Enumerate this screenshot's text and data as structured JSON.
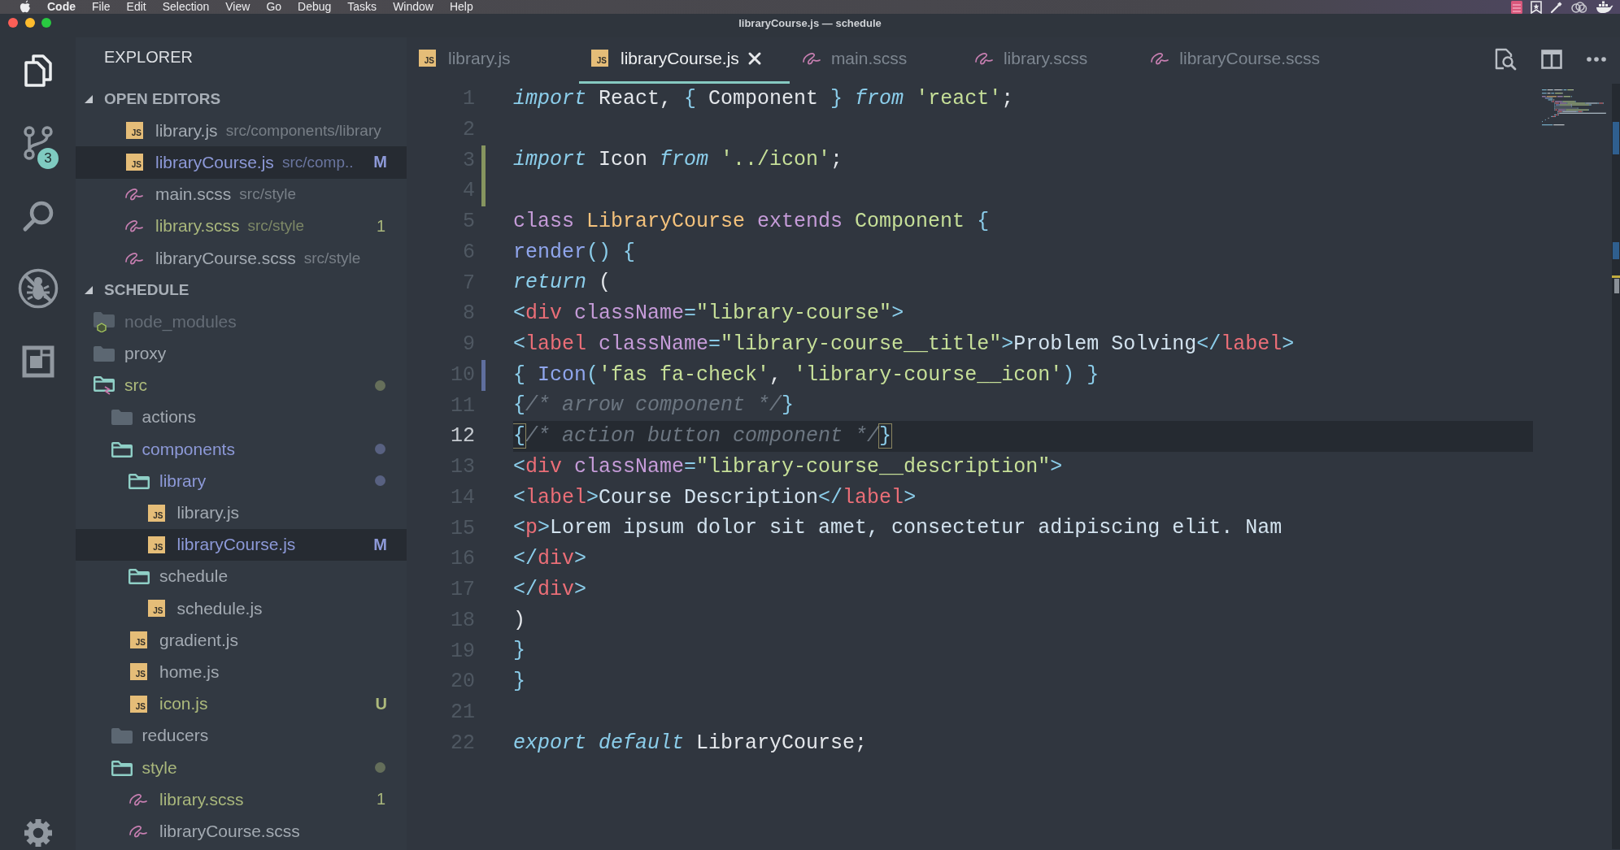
{
  "menu_bar": {
    "app_name": "Code",
    "items": [
      "File",
      "Edit",
      "Selection",
      "View",
      "Go",
      "Debug",
      "Tasks",
      "Window",
      "Help"
    ]
  },
  "window": {
    "title": "libraryCourse.js — schedule"
  },
  "activity_bar": {
    "items": [
      {
        "kind": "files",
        "selected": true
      },
      {
        "kind": "source-control",
        "selected": false,
        "badge": "3"
      },
      {
        "kind": "search",
        "selected": false
      },
      {
        "kind": "debug",
        "selected": false
      },
      {
        "kind": "extensions",
        "selected": false
      }
    ],
    "footer_items": [
      {
        "kind": "settings",
        "selected": false
      }
    ]
  },
  "sidebar": {
    "title": "EXPLORER",
    "sections": [
      {
        "title": "OPEN EDITORS",
        "expanded": true,
        "items": [
          {
            "name": "library.js",
            "path": "src/components/library",
            "kind": "js",
            "icon_label": "JS",
            "color": "#a3aab2",
            "selected": false
          },
          {
            "name": "libraryCourse.js",
            "path": "src/comp..",
            "kind": "js",
            "icon_label": "JS",
            "color": "#8d99d8",
            "badge": {
              "text": "M",
              "kind": "git"
            },
            "selected": true
          },
          {
            "name": "main.scss",
            "path": "src/style",
            "kind": "scss",
            "color": "#a3aab2",
            "selected": false
          },
          {
            "name": "library.scss",
            "path": "src/style",
            "kind": "scss",
            "color": "#a9b77c",
            "badge": {
              "text": "1",
              "kind": "problems"
            },
            "selected": false
          },
          {
            "name": "libraryCourse.scss",
            "path": "src/style",
            "kind": "scss",
            "color": "#a3aab2",
            "selected": false
          }
        ]
      },
      {
        "title": "SCHEDULE",
        "expanded": true,
        "tree": [
          {
            "name": "node_modules",
            "kind": "node-folder",
            "expanded": false,
            "dot": false,
            "color": "#646c76",
            "selected": false
          },
          {
            "name": "proxy",
            "kind": "folder",
            "expanded": false,
            "dot": false,
            "color": "#a3aab2",
            "selected": false
          },
          {
            "name": "src",
            "kind": "src-folder",
            "expanded": true,
            "dot": true,
            "color": "#adba7c",
            "selected": false,
            "children": [
              {
                "name": "actions",
                "kind": "folder",
                "expanded": false,
                "dot": false,
                "color": "#a3aab2",
                "selected": false
              },
              {
                "name": "components",
                "kind": "folder",
                "expanded": true,
                "dot": true,
                "color": "#8d99d8",
                "selected": false,
                "children": [
                  {
                    "name": "library",
                    "kind": "folder",
                    "expanded": true,
                    "dot": true,
                    "color": "#8d99d8",
                    "selected": false,
                    "children": [
                      {
                        "name": "library.js",
                        "kind": "js",
                        "icon_label": "JS",
                        "color": "#a3aab2",
                        "selected": false
                      },
                      {
                        "name": "libraryCourse.js",
                        "kind": "js",
                        "icon_label": "JS",
                        "color": "#8d99d8",
                        "badge": {
                          "text": "M",
                          "kind": "git"
                        },
                        "selected": true
                      }
                    ]
                  },
                  {
                    "name": "schedule",
                    "kind": "folder",
                    "expanded": true,
                    "dot": false,
                    "color": "#a3aab2",
                    "selected": false,
                    "children": [
                      {
                        "name": "schedule.js",
                        "kind": "js",
                        "icon_label": "JS",
                        "color": "#a3aab2",
                        "selected": false
                      }
                    ]
                  },
                  {
                    "name": "gradient.js",
                    "kind": "js",
                    "icon_label": "JS",
                    "color": "#a3aab2",
                    "selected": false
                  },
                  {
                    "name": "home.js",
                    "kind": "js",
                    "icon_label": "JS",
                    "color": "#a3aab2",
                    "selected": false
                  },
                  {
                    "name": "icon.js",
                    "kind": "js",
                    "icon_label": "JS",
                    "color": "#adba7c",
                    "badge": {
                      "text": "U",
                      "kind": "git"
                    },
                    "selected": false
                  }
                ]
              },
              {
                "name": "reducers",
                "kind": "folder",
                "expanded": false,
                "dot": false,
                "color": "#a3aab2",
                "selected": false
              },
              {
                "name": "style",
                "kind": "folder",
                "expanded": true,
                "dot": true,
                "color": "#a9b77c",
                "selected": false,
                "children": [
                  {
                    "name": "library.scss",
                    "kind": "scss",
                    "color": "#a9b77c",
                    "badge": {
                      "text": "1",
                      "kind": "problems"
                    },
                    "selected": false
                  },
                  {
                    "name": "libraryCourse.scss",
                    "kind": "scss",
                    "color": "#a3aab2",
                    "selected": false
                  }
                ]
              }
            ]
          }
        ]
      }
    ]
  },
  "editor": {
    "tabs": [
      {
        "label": "library.js",
        "kind": "js",
        "icon_label": "JS",
        "selected": false
      },
      {
        "label": "libraryCourse.js",
        "kind": "js",
        "icon_label": "JS",
        "selected": true
      },
      {
        "label": "main.scss",
        "kind": "scss",
        "selected": false
      },
      {
        "label": "library.scss",
        "kind": "scss",
        "selected": false
      },
      {
        "label": "libraryCourse.scss",
        "kind": "scss",
        "selected": false
      }
    ],
    "lines": [
      {
        "number": "1",
        "current": false,
        "tokens": [
          {
            "text": "import",
            "kind": "keyword"
          },
          {
            "text": " React, ",
            "kind": "plain"
          },
          {
            "text": "{",
            "kind": "punct"
          },
          {
            "text": " Component ",
            "kind": "plain"
          },
          {
            "text": "}",
            "kind": "punct"
          },
          {
            "text": " from",
            "kind": "keyword"
          },
          {
            "text": " 'react'",
            "kind": "string"
          },
          {
            "text": ";",
            "kind": "plain"
          }
        ]
      },
      {
        "number": "2",
        "current": false
      },
      {
        "number": "3",
        "current": false,
        "marker": {
          "kind": "added"
        },
        "tokens": [
          {
            "text": "import",
            "kind": "keyword"
          },
          {
            "text": " Icon",
            "kind": "plain"
          },
          {
            "text": " from",
            "kind": "keyword"
          },
          {
            "text": " '../icon'",
            "kind": "string"
          },
          {
            "text": ";",
            "kind": "plain"
          }
        ]
      },
      {
        "number": "4",
        "current": false,
        "marker": {
          "kind": "added"
        }
      },
      {
        "number": "5",
        "current": false,
        "tokens": [
          {
            "text": "class",
            "kind": "storage"
          },
          {
            "text": " LibraryCourse",
            "kind": "class"
          },
          {
            "text": " extends",
            "kind": "storage"
          },
          {
            "text": " Component",
            "kind": "inherited"
          },
          {
            "text": " {",
            "kind": "punct"
          }
        ]
      },
      {
        "number": "6",
        "current": false,
        "tokens": [
          {
            "text": "    render",
            "kind": "function"
          },
          {
            "text": "() {",
            "kind": "punct"
          }
        ]
      },
      {
        "number": "7",
        "current": false,
        "tokens": [
          {
            "text": "        return",
            "kind": "keyword"
          },
          {
            "text": " (",
            "kind": "plain"
          }
        ]
      },
      {
        "number": "8",
        "current": false,
        "tokens": [
          {
            "text": "            <",
            "kind": "punct"
          },
          {
            "text": "div",
            "kind": "tag"
          },
          {
            "text": " className",
            "kind": "attr"
          },
          {
            "text": "=",
            "kind": "punct"
          },
          {
            "text": "\"library-course\"",
            "kind": "string"
          },
          {
            "text": ">",
            "kind": "punct"
          }
        ]
      },
      {
        "number": "9",
        "current": false,
        "tokens": [
          {
            "text": "                <",
            "kind": "punct"
          },
          {
            "text": "label",
            "kind": "tag"
          },
          {
            "text": " className",
            "kind": "attr"
          },
          {
            "text": "=",
            "kind": "punct"
          },
          {
            "text": "\"library-course__title\"",
            "kind": "string"
          },
          {
            "text": ">",
            "kind": "punct"
          },
          {
            "text": "Problem Solving",
            "kind": "text"
          },
          {
            "text": "</",
            "kind": "punct"
          },
          {
            "text": "label",
            "kind": "tag"
          },
          {
            "text": ">",
            "kind": "punct"
          }
        ]
      },
      {
        "number": "10",
        "current": false,
        "marker": {
          "kind": "modified"
        },
        "tokens": [
          {
            "text": "                {",
            "kind": "punct"
          },
          {
            "text": " Icon",
            "kind": "function"
          },
          {
            "text": "(",
            "kind": "punct"
          },
          {
            "text": "'fas fa-check'",
            "kind": "string"
          },
          {
            "text": ", ",
            "kind": "plain"
          },
          {
            "text": "'library-course__icon'",
            "kind": "string"
          },
          {
            "text": ") }",
            "kind": "punct"
          }
        ]
      },
      {
        "number": "11",
        "current": false,
        "tokens": [
          {
            "text": "                {",
            "kind": "punct"
          },
          {
            "text": "/* arrow component */",
            "kind": "comment"
          },
          {
            "text": "}",
            "kind": "punct"
          }
        ]
      },
      {
        "number": "12",
        "current": true,
        "tokens": [
          {
            "text": "                {",
            "kind": "match"
          },
          {
            "text": "/* action button component */",
            "kind": "comment"
          },
          {
            "text": "}",
            "kind": "match"
          }
        ]
      },
      {
        "number": "13",
        "current": false,
        "tokens": [
          {
            "text": "                <",
            "kind": "punct"
          },
          {
            "text": "div",
            "kind": "tag"
          },
          {
            "text": " className",
            "kind": "attr"
          },
          {
            "text": "=",
            "kind": "punct"
          },
          {
            "text": "\"library-course__description\"",
            "kind": "string"
          },
          {
            "text": ">",
            "kind": "punct"
          }
        ]
      },
      {
        "number": "14",
        "current": false,
        "tokens": [
          {
            "text": "                    <",
            "kind": "punct"
          },
          {
            "text": "label",
            "kind": "tag"
          },
          {
            "text": ">",
            "kind": "punct"
          },
          {
            "text": "Course Description",
            "kind": "text"
          },
          {
            "text": "</",
            "kind": "punct"
          },
          {
            "text": "label",
            "kind": "tag"
          },
          {
            "text": ">",
            "kind": "punct"
          }
        ]
      },
      {
        "number": "15",
        "current": false,
        "tokens": [
          {
            "text": "                    <",
            "kind": "punct"
          },
          {
            "text": "p",
            "kind": "tag"
          },
          {
            "text": ">",
            "kind": "punct"
          },
          {
            "text": "Lorem ipsum dolor sit amet, consectetur adipiscing elit. Nam",
            "kind": "text"
          }
        ]
      },
      {
        "number": "16",
        "current": false,
        "tokens": [
          {
            "text": "                </",
            "kind": "punct"
          },
          {
            "text": "div",
            "kind": "tag"
          },
          {
            "text": ">",
            "kind": "punct"
          }
        ]
      },
      {
        "number": "17",
        "current": false,
        "tokens": [
          {
            "text": "            </",
            "kind": "punct"
          },
          {
            "text": "div",
            "kind": "tag"
          },
          {
            "text": ">",
            "kind": "punct"
          }
        ]
      },
      {
        "number": "18",
        "current": false,
        "tokens": [
          {
            "text": "        )",
            "kind": "plain"
          }
        ]
      },
      {
        "number": "19",
        "current": false,
        "tokens": [
          {
            "text": "    }",
            "kind": "punct"
          }
        ]
      },
      {
        "number": "20",
        "current": false,
        "tokens": [
          {
            "text": "}",
            "kind": "punct"
          }
        ]
      },
      {
        "number": "21",
        "current": false
      },
      {
        "number": "22",
        "current": false,
        "tokens": [
          {
            "text": "export default",
            "kind": "keyword"
          },
          {
            "text": " LibraryCourse;",
            "kind": "plain"
          }
        ]
      }
    ]
  }
}
